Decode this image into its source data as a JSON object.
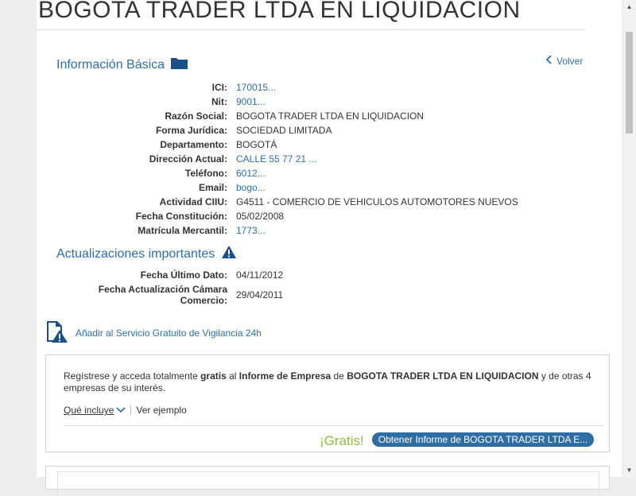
{
  "header": {
    "company_name": "BOGOTA TRADER LTDA EN LIQUIDACION"
  },
  "basic_info": {
    "title": "Información Básica",
    "back_label": "Volver",
    "rows": [
      {
        "label": "ICI:",
        "value": "170015...",
        "link": true
      },
      {
        "label": "Nit:",
        "value": "9001...",
        "link": true
      },
      {
        "label": "Razón Social:",
        "value": "BOGOTA TRADER LTDA EN LIQUIDACION",
        "link": false
      },
      {
        "label": "Forma Jurídica:",
        "value": "SOCIEDAD LIMITADA",
        "link": false
      },
      {
        "label": "Departamento:",
        "value": "BOGOTÁ",
        "link": false
      },
      {
        "label": "Dirección Actual:",
        "value": "CALLE 55 77 21 ...",
        "link": true
      },
      {
        "label": "Teléfono:",
        "value": "6012...",
        "link": true
      },
      {
        "label": "Email:",
        "value": "bogo...",
        "link": true
      },
      {
        "label": "Actividad CIIU:",
        "value": "G4511 - COMERCIO DE VEHICULOS AUTOMOTORES NUEVOS",
        "link": false
      },
      {
        "label": "Fecha Constitución:",
        "value": "05/02/2008",
        "link": false
      },
      {
        "label": "Matrícula Mercantil:",
        "value": "1773...",
        "link": true
      }
    ]
  },
  "updates": {
    "title": "Actualizaciones importantes",
    "last_data_label": "Fecha Último Dato:",
    "last_data_value": "04/11/2012",
    "chamber_label_line1": "Fecha Actualización Cámara",
    "chamber_label_line2": "Comercio:",
    "chamber_value": "29/04/2011"
  },
  "vigilance": {
    "label": "Añadir al Servicio Gratuito de Vigilancia 24h"
  },
  "promo": {
    "text_1": "Regístrese y acceda totalmente ",
    "text_bold_1": "gratis",
    "text_2": " al ",
    "text_bold_2": "Informe de Empresa",
    "text_3": " de ",
    "text_bold_3": "BOGOTA TRADER LTDA EN LIQUIDACION",
    "text_4": " y de otras 4 empresas de su interés.",
    "what_includes": "Qué incluye",
    "see_example": "Ver ejemplo",
    "free_label": "¡Gratis!",
    "cta_label": "Obtener Informe de BOGOTA TRADER LTDA E..."
  },
  "colors": {
    "accent": "#2f6ea5",
    "free_green": "#8cbf3f",
    "warning_blue": "#1a4f8a"
  }
}
